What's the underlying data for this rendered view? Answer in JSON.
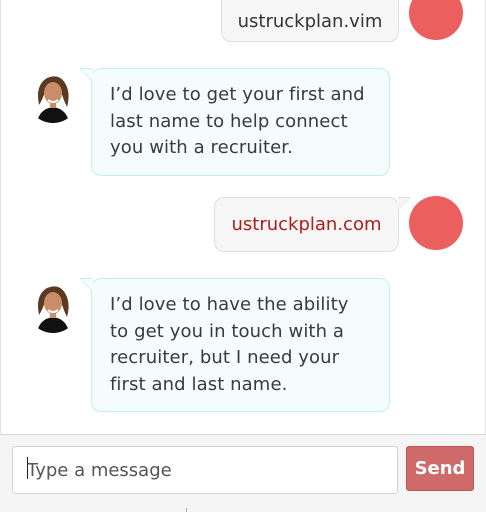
{
  "messages": [
    {
      "sender": "user",
      "text": "ustruckplan.vim",
      "color": "#333333"
    },
    {
      "sender": "bot",
      "text": "I’d love to get your first and last name to help connect you with a recruiter."
    },
    {
      "sender": "user",
      "text": "ustruckplan.com",
      "color": "#b01c1c"
    },
    {
      "sender": "bot",
      "text": "I’d love to have the ability to get you in touch with a recruiter, but I need your first and last name."
    }
  ],
  "composer": {
    "placeholder": "Type a message",
    "send_label": "Send"
  },
  "colors": {
    "user_avatar": "#ec5f5f",
    "send_button": "#cf6a6a",
    "bot_bubble_bg": "#f4fcfd",
    "bot_bubble_border": "#c5eef3"
  }
}
